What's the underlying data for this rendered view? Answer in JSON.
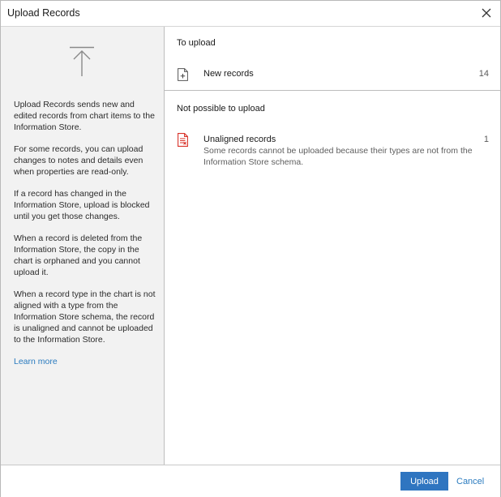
{
  "window": {
    "title": "Upload Records"
  },
  "sidebar": {
    "icon": "upload-arrow-icon",
    "paragraphs": [
      "Upload Records sends new and edited records from chart items to the Information Store.",
      "For some records, you can upload changes to notes and details even when properties are read-only.",
      "If a record has changed in the Information Store, upload is blocked until you get those changes.",
      "When a record is deleted from the Information Store, the copy in the chart is orphaned and you cannot upload it.",
      "When a record type in the chart is not aligned with a type from the Information Store schema, the record is unaligned and cannot be uploaded to the Information Store."
    ],
    "learn_more": "Learn more"
  },
  "main": {
    "to_upload": {
      "title": "To upload",
      "items": [
        {
          "icon": "new-record-icon",
          "label": "New records",
          "count": "14"
        }
      ]
    },
    "not_possible": {
      "title": "Not possible to upload",
      "items": [
        {
          "icon": "unaligned-record-icon",
          "label": "Unaligned records",
          "count": "1",
          "description": "Some records cannot be uploaded because their types are not from the Information Store schema."
        }
      ]
    }
  },
  "footer": {
    "upload_label": "Upload",
    "cancel_label": "Cancel"
  },
  "colors": {
    "accent": "#2f75c0",
    "link": "#2a7bbf",
    "error": "#d9332a",
    "sidebar_bg": "#f2f2f2"
  }
}
